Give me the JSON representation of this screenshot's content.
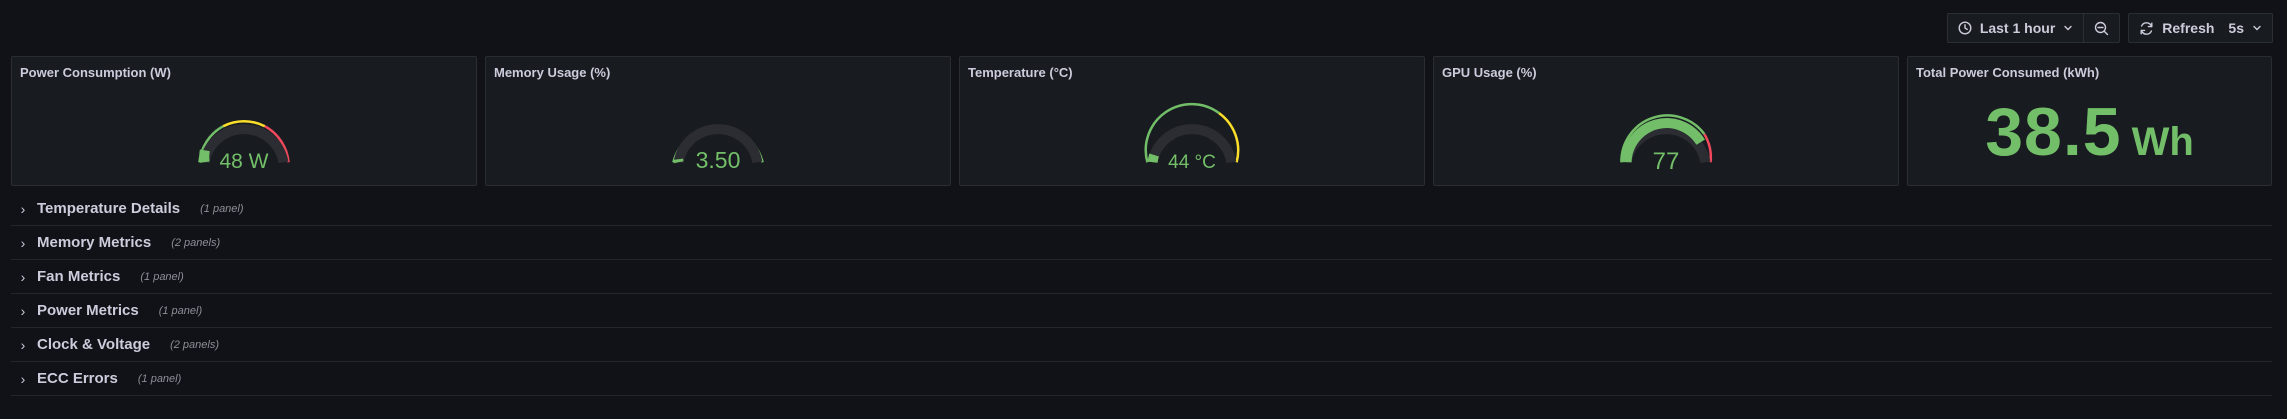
{
  "toolbar": {
    "time_range": "Last 1 hour",
    "refresh_label": "Refresh",
    "refresh_interval": "5s",
    "icons": [
      "clock-icon",
      "chevron-down-icon",
      "zoom-out-icon",
      "refresh-icon"
    ]
  },
  "panels": [
    {
      "title": "Power Consumption (W)",
      "value_text": "48 W",
      "value": 48,
      "min": 0,
      "max": 250
    },
    {
      "title": "Memory Usage (%)",
      "value_text": "3.50",
      "value": 3.5,
      "min": 0,
      "max": 100
    },
    {
      "title": "Temperature (°C)",
      "value_text": "44 °C",
      "value": 44,
      "min": 0,
      "max": 100
    },
    {
      "title": "GPU Usage (%)",
      "value_text": "77",
      "value": 77,
      "min": 0,
      "max": 100
    },
    {
      "title": "Total Power Consumed (kWh)",
      "value_text": "38.5",
      "unit": "Wh"
    }
  ],
  "rows": [
    {
      "title": "Temperature Details",
      "count": "(1 panel)"
    },
    {
      "title": "Memory Metrics",
      "count": "(2 panels)"
    },
    {
      "title": "Fan Metrics",
      "count": "(1 panel)"
    },
    {
      "title": "Power Metrics",
      "count": "(1 panel)"
    },
    {
      "title": "Clock & Voltage",
      "count": "(2 panels)"
    },
    {
      "title": "ECC Errors",
      "count": "(1 panel)"
    }
  ],
  "colors": {
    "value": "#73bf69",
    "track": "#2b2d33",
    "threshold_green": "#73bf69",
    "threshold_yellow": "#fade2a",
    "threshold_red": "#f2495c"
  }
}
